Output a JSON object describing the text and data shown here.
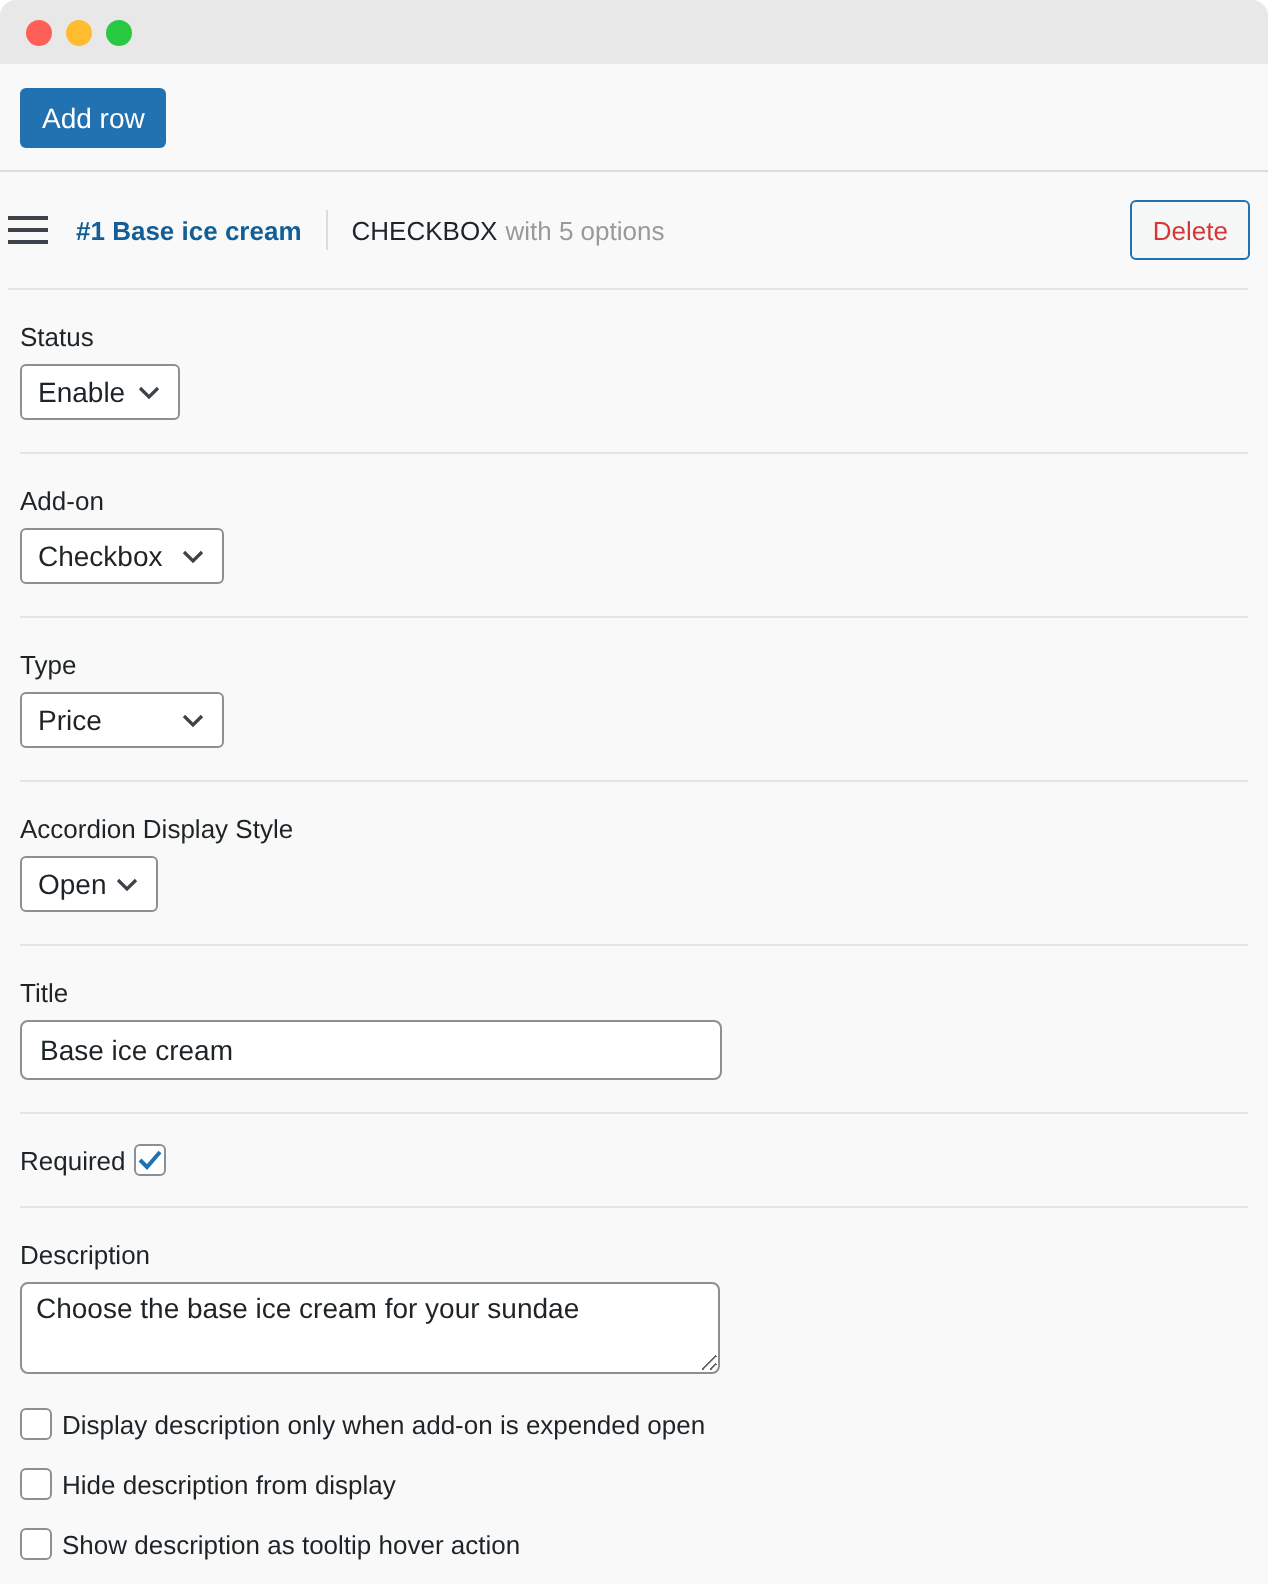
{
  "toolbar": {
    "add_button": "Add row"
  },
  "row_header": {
    "title": "#1 Base ice cream",
    "type": "CHECKBOX",
    "summary": "with 5 options",
    "delete_button": "Delete"
  },
  "fields": [
    {
      "kind": "select",
      "label": "Status",
      "value": "Enable"
    },
    {
      "kind": "select",
      "label": "Add-on",
      "value": "Checkbox"
    },
    {
      "kind": "select",
      "label": "Type",
      "value": "Price"
    },
    {
      "kind": "select",
      "label": "Accordion Display Style",
      "value": "Open"
    },
    {
      "kind": "text",
      "label": "Title",
      "value": "Base ice cream"
    },
    {
      "kind": "checkbox",
      "label": "Required",
      "checked": true
    },
    {
      "kind": "textarea",
      "label": "Description",
      "value": "Choose the base ice cream for your sundae"
    }
  ],
  "description_options": [
    {
      "label": "Display description only when add-on is expended open",
      "checked": false
    },
    {
      "label": "Hide description from display",
      "checked": false
    },
    {
      "label": "Show description as tooltip hover action",
      "checked": false
    }
  ]
}
